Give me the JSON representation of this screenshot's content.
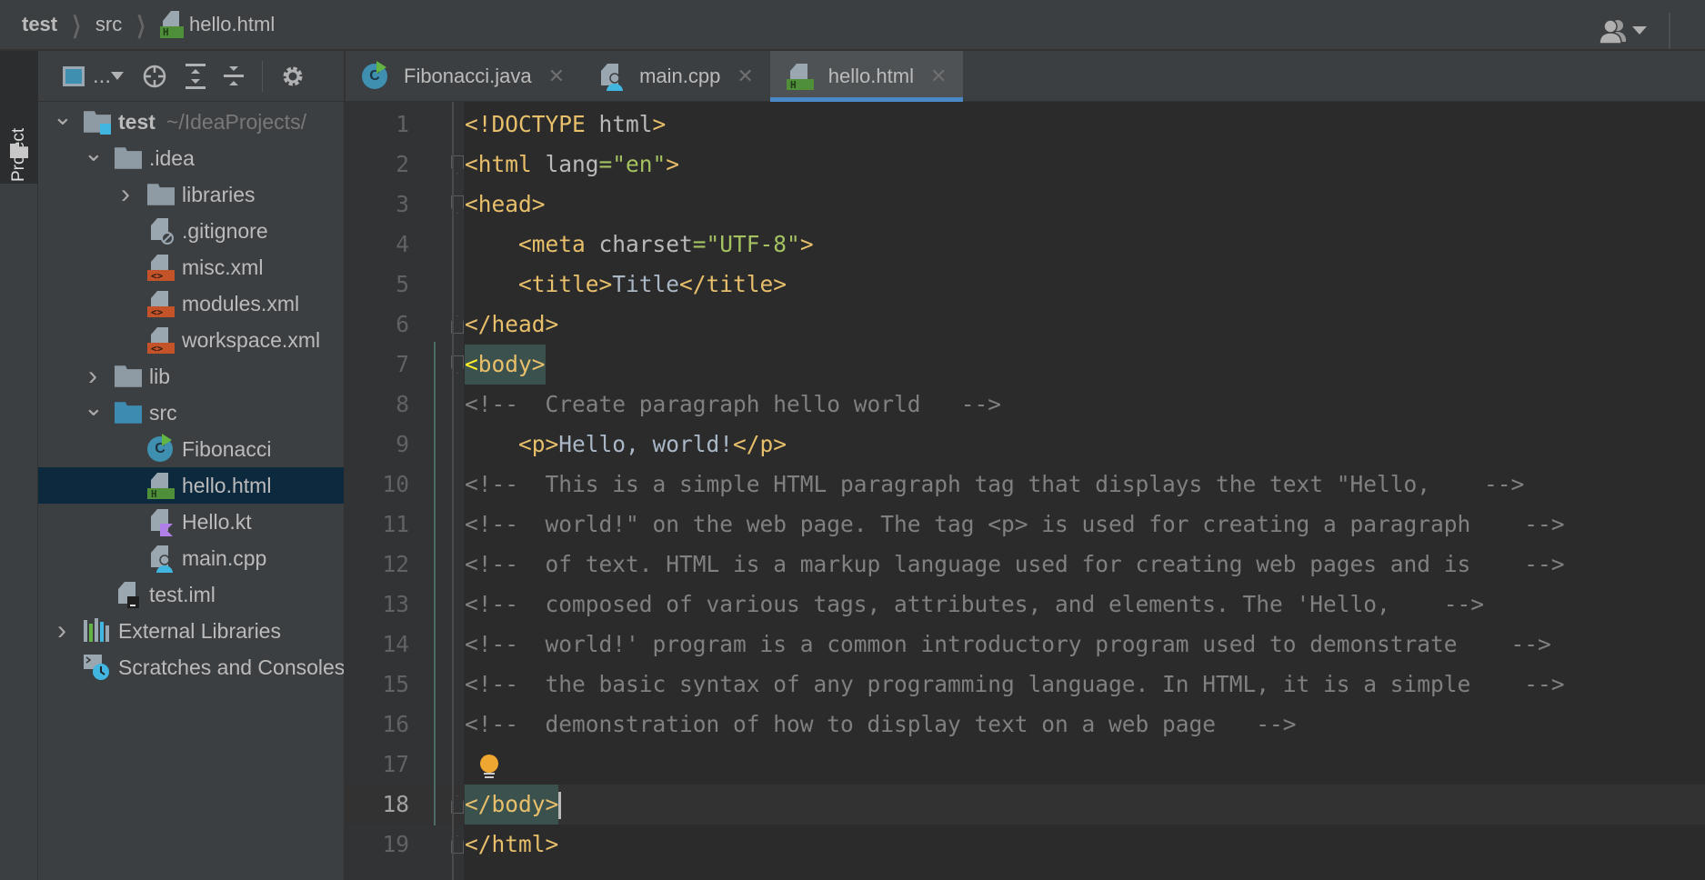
{
  "breadcrumb": [
    "test",
    "src",
    "hello.html"
  ],
  "sidebar": {
    "stripe_label": "Project",
    "toolbar": {
      "view_label": "..."
    },
    "tree": [
      {
        "label": "test",
        "extra": "~/IdeaProjects/",
        "level": 0,
        "chev": "down",
        "icon": "module-folder"
      },
      {
        "label": ".idea",
        "level": 1,
        "chev": "down",
        "icon": "folder"
      },
      {
        "label": "libraries",
        "level": 2,
        "chev": "right",
        "icon": "folder"
      },
      {
        "label": ".gitignore",
        "level": 2,
        "icon": "ignore-file"
      },
      {
        "label": "misc.xml",
        "level": 2,
        "icon": "xml-file"
      },
      {
        "label": "modules.xml",
        "level": 2,
        "icon": "xml-file"
      },
      {
        "label": "workspace.xml",
        "level": 2,
        "icon": "xml-file"
      },
      {
        "label": "lib",
        "level": 1,
        "chev": "right",
        "icon": "folder"
      },
      {
        "label": "src",
        "level": 1,
        "chev": "down",
        "icon": "source-folder"
      },
      {
        "label": "Fibonacci",
        "level": 2,
        "icon": "java-class"
      },
      {
        "label": "hello.html",
        "level": 2,
        "icon": "html-file",
        "selected": true
      },
      {
        "label": "Hello.kt",
        "level": 2,
        "icon": "kotlin-file"
      },
      {
        "label": "main.cpp",
        "level": 2,
        "icon": "cpp-file"
      },
      {
        "label": "test.iml",
        "level": 1,
        "icon": "iml-file"
      },
      {
        "label": "External Libraries",
        "level": 0,
        "chev": "right",
        "icon": "libraries"
      },
      {
        "label": "Scratches and Consoles",
        "level": 0,
        "icon": "scratches"
      }
    ]
  },
  "tabs": [
    {
      "label": "Fibonacci.java",
      "icon": "java-class"
    },
    {
      "label": "main.cpp",
      "icon": "cpp-file"
    },
    {
      "label": "hello.html",
      "icon": "html-file",
      "active": true
    }
  ],
  "colors": {
    "tag": "#e8bf6a",
    "attr": "#bababa",
    "string": "#a5c261",
    "text": "#a9b7c6",
    "comment": "#808080",
    "accent": "#4a88c7",
    "selection": "#0d293e"
  },
  "editor": {
    "current_line": 18,
    "lines": [
      [
        [
          "tag",
          "<!DOCTYPE"
        ],
        [
          "attr",
          " html"
        ],
        [
          "tag",
          ">"
        ]
      ],
      [
        [
          "tag",
          "<html"
        ],
        [
          "attr",
          " lang"
        ],
        [
          "str",
          "=\"en\""
        ],
        [
          "tag",
          ">"
        ]
      ],
      [
        [
          "tag",
          "<head>"
        ]
      ],
      [
        [
          "txt",
          "    "
        ],
        [
          "tag",
          "<meta"
        ],
        [
          "attr",
          " charset"
        ],
        [
          "str",
          "=\"UTF-8\""
        ],
        [
          "tag",
          ">"
        ]
      ],
      [
        [
          "txt",
          "    "
        ],
        [
          "tag",
          "<title>"
        ],
        [
          "txt",
          "Title"
        ],
        [
          "tag",
          "</title>"
        ]
      ],
      [
        [
          "tag",
          "</head>"
        ]
      ],
      [
        [
          "hl",
          "<body>"
        ]
      ],
      [
        [
          "com",
          "<!--  Create paragraph hello world   -->"
        ]
      ],
      [
        [
          "txt",
          "    "
        ],
        [
          "tag",
          "<p>"
        ],
        [
          "txt",
          "Hello, world!"
        ],
        [
          "tag",
          "</p>"
        ]
      ],
      [
        [
          "com",
          "<!--  This is a simple HTML paragraph tag that displays the text \"Hello,    -->"
        ]
      ],
      [
        [
          "com",
          "<!--  world!\" on the web page. The tag <p> is used for creating a paragraph    -->"
        ]
      ],
      [
        [
          "com",
          "<!--  of text. HTML is a markup language used for creating web pages and is    -->"
        ]
      ],
      [
        [
          "com",
          "<!--  composed of various tags, attributes, and elements. The 'Hello,    -->"
        ]
      ],
      [
        [
          "com",
          "<!--  world!' program is a common introductory program used to demonstrate    -->"
        ]
      ],
      [
        [
          "com",
          "<!--  the basic syntax of any programming language. In HTML, it is a simple    -->"
        ]
      ],
      [
        [
          "com",
          "<!--  demonstration of how to display text on a web page   -->"
        ]
      ],
      [],
      [
        [
          "hl2",
          "</body>"
        ]
      ],
      [
        [
          "tag",
          "</html>"
        ]
      ]
    ],
    "fold_lines": [
      2,
      3,
      6,
      7,
      18,
      19
    ]
  }
}
